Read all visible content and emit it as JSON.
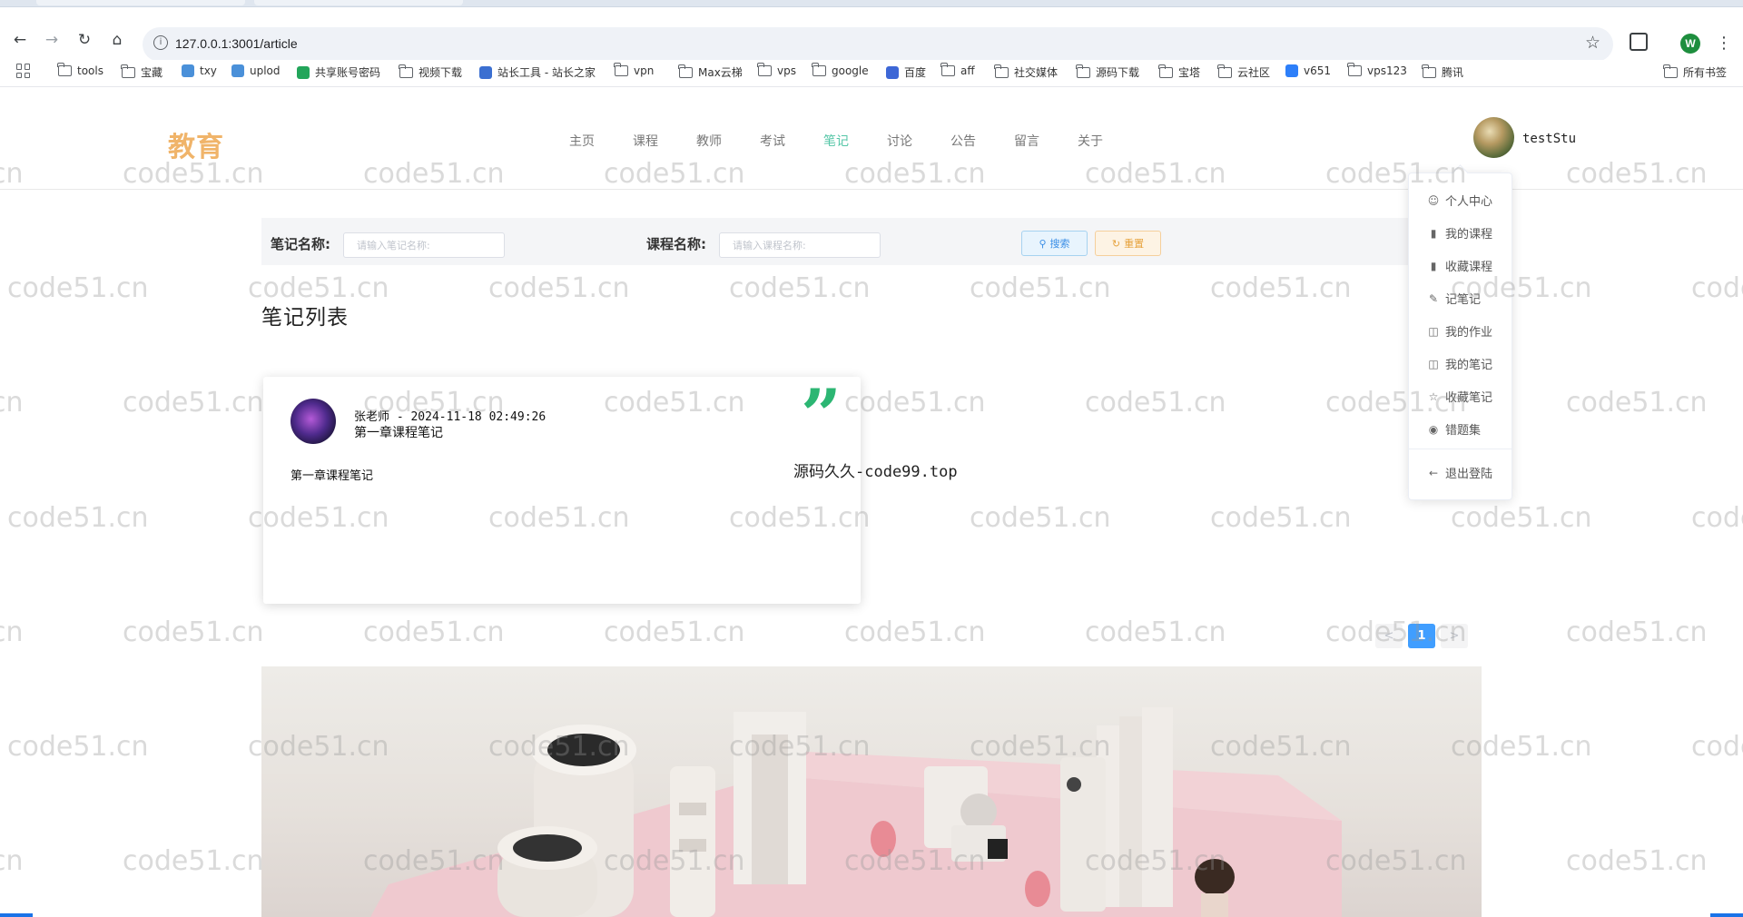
{
  "browser": {
    "url": "127.0.0.1:3001/article",
    "bookmarks": [
      "tools",
      "宝藏",
      "txy",
      "uplod",
      "共享账号密码",
      "视频下载",
      "站长工具 - 站长之家",
      "vpn",
      "Max云梯",
      "vps",
      "google",
      "百度",
      "aff",
      "社交媒体",
      "源码下载",
      "宝塔",
      "云社区",
      "v651",
      "vps123",
      "腾讯"
    ],
    "all_bookmarks": "所有书签",
    "profile_initial": "W"
  },
  "site": {
    "logo": "教育",
    "nav": [
      "主页",
      "课程",
      "教师",
      "考试",
      "笔记",
      "讨论",
      "公告",
      "留言",
      "关于"
    ],
    "active_nav": "笔记",
    "username": "testStu"
  },
  "search": {
    "note_label": "笔记名称:",
    "note_placeholder": "请输入笔记名称:",
    "course_label": "课程名称:",
    "course_placeholder": "请输入课程名称:",
    "search_button": "搜索",
    "reset_button": "重置"
  },
  "page": {
    "title": "笔记列表"
  },
  "notes": [
    {
      "meta": "张老师 - 2024-11-18 02:49:26",
      "subtitle": "第一章课程笔记",
      "body": "第一章课程笔记"
    }
  ],
  "promo_text": "源码久久-code99.top",
  "pagination": {
    "prev": "<",
    "current": "1",
    "next": ">"
  },
  "user_menu": [
    "个人中心",
    "我的课程",
    "收藏课程",
    "记笔记",
    "我的作业",
    "我的笔记",
    "收藏笔记",
    "错题集"
  ],
  "logout": "退出登陆",
  "watermark": "code51.cn",
  "colors": {
    "accent": "#55c6a7",
    "logo": "#f0b46a",
    "quote": "#2cb673",
    "pagination_active": "#409eff"
  }
}
